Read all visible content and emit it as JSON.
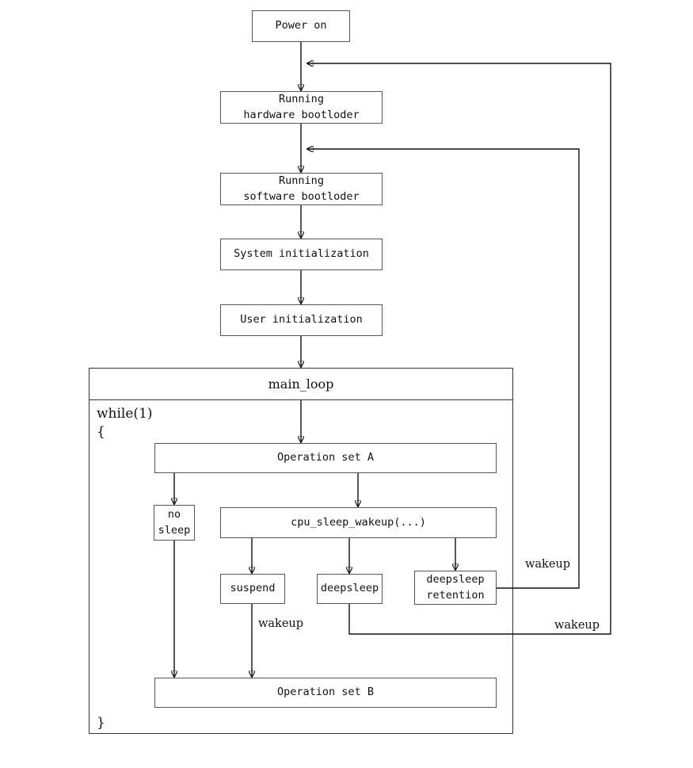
{
  "diagram": {
    "title": "Power-on to main_loop power management flow",
    "colors": {
      "background": "#ffffff",
      "node_border": "#555555",
      "group_border": "#333333",
      "wire": "#111111",
      "text": "#111111"
    },
    "nodes": {
      "power_on": "Power on",
      "running_hardware_bootloader": "Running\nhardware bootloder",
      "running_software_bootloader": "Running\nsoftware bootloder",
      "system_initialization": "System initialization",
      "user_initialization": "User initialization",
      "main_loop": "main_loop",
      "while_open": "while(1)\n{",
      "while_close": "}",
      "operation_set_a": "Operation set A",
      "no_sleep": "no\nsleep",
      "cpu_sleep_wakeup": "cpu_sleep_wakeup(...)",
      "suspend": "suspend",
      "deepsleep": "deepsleep",
      "deepsleep_retention": "deepsleep\nretention",
      "operation_set_b": "Operation set B"
    },
    "edge_labels": {
      "suspend_wakeup": "wakeup",
      "retention_wakeup": "wakeup",
      "deepsleep_wakeup": "wakeup"
    }
  }
}
